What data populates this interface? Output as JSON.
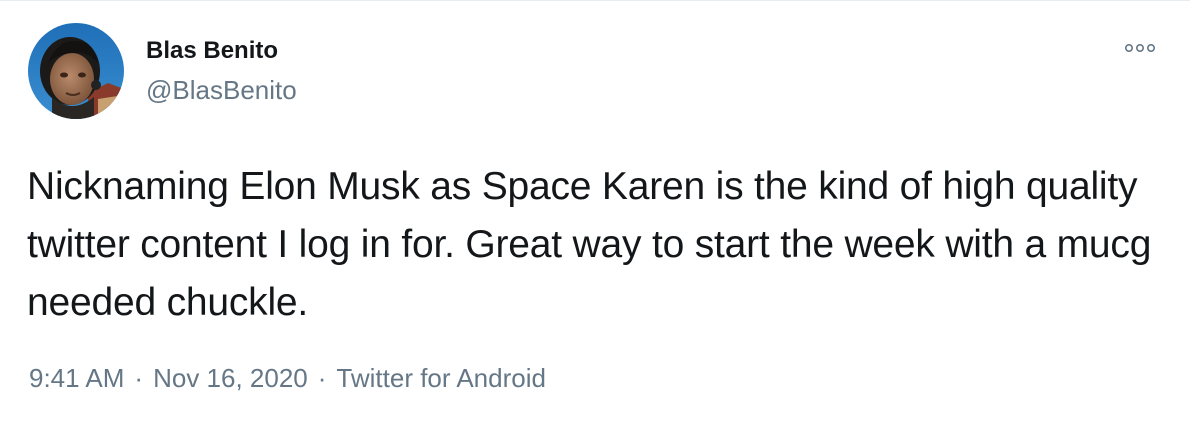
{
  "tweet": {
    "author": {
      "display_name": "Blas Benito",
      "handle": "@BlasBenito"
    },
    "text": "Nicknaming Elon Musk as Space Karen is the kind of high quality twitter content I log in for. Great way to start the week with a mucg needed chuckle.",
    "time": "9:41 AM",
    "date": "Nov 16, 2020",
    "source": "Twitter for Android",
    "separator": "·"
  },
  "icons": {
    "more": "more-options-icon"
  },
  "colors": {
    "primary_text": "#14171a",
    "secondary_text": "#657786",
    "border": "#e6ecf0"
  }
}
